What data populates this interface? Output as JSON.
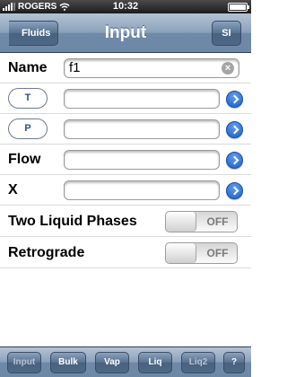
{
  "status_bar": {
    "carrier": "ROGERS",
    "time": "10:32"
  },
  "nav": {
    "back_label": "Fluids",
    "title": "Input",
    "unit_label": "SI"
  },
  "form": {
    "name": {
      "label": "Name",
      "value": "f1"
    },
    "t": {
      "label": "T",
      "value": ""
    },
    "p": {
      "label": "P",
      "value": ""
    },
    "flow": {
      "label": "Flow",
      "value": ""
    },
    "x": {
      "label": "X",
      "value": ""
    },
    "two_liquid": {
      "label": "Two Liquid Phases",
      "state": "OFF"
    },
    "retrograde": {
      "label": "Retrograde",
      "state": "OFF"
    }
  },
  "toolbar": {
    "items": [
      {
        "label": "Input",
        "enabled": false
      },
      {
        "label": "Bulk",
        "enabled": true
      },
      {
        "label": "Vap",
        "enabled": true
      },
      {
        "label": "Liq",
        "enabled": true
      },
      {
        "label": "Liq2",
        "enabled": false
      },
      {
        "label": "?",
        "enabled": true
      }
    ]
  },
  "colors": {
    "nav_blue": "#6f89a8",
    "disclosure_blue": "#1c5fc8"
  }
}
